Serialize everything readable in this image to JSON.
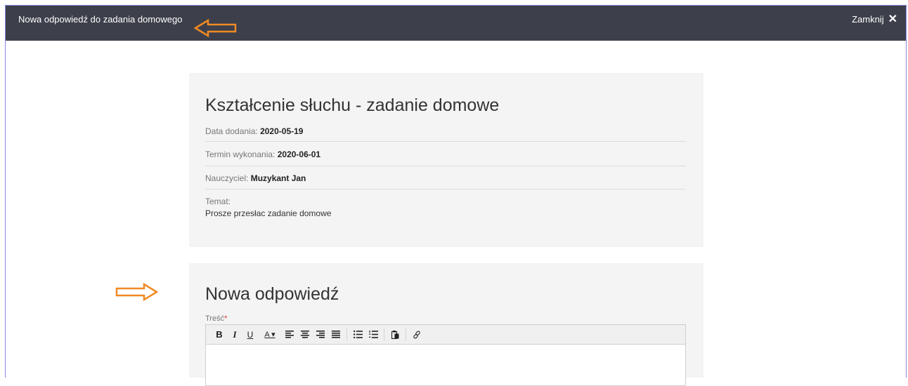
{
  "topbar": {
    "title": "Nowa odpowiedź do zadania domowego",
    "close_label": "Zamknij",
    "close_icon": "✕"
  },
  "homework": {
    "title": "Kształcenie słuchu - zadanie domowe",
    "date_added_label": "Data dodania:",
    "date_added_value": "2020-05-19",
    "due_label": "Termin wykonania:",
    "due_value": "2020-06-01",
    "teacher_label": "Nauczyciel:",
    "teacher_value": "Muzykant Jan",
    "topic_label": "Temat:",
    "topic_value": "Prosze przesłac zadanie domowe"
  },
  "reply": {
    "title": "Nowa odpowiedź",
    "content_label": "Treść",
    "required_mark": "*",
    "toolbar": {
      "bold": "B",
      "italic": "I",
      "underline": "U",
      "font_color": "A ▾"
    }
  },
  "colors": {
    "topbar_bg": "#3d404b",
    "arrow": "#f08a24",
    "card_bg": "#f4f4f4"
  }
}
